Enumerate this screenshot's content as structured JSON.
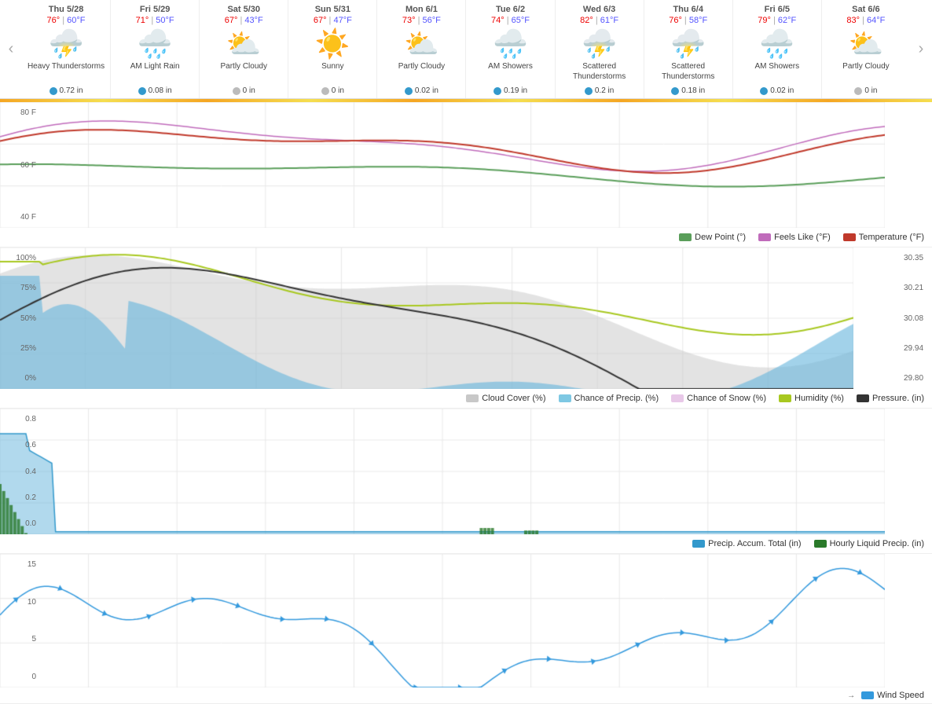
{
  "nav": {
    "prev_label": "‹",
    "next_label": "›"
  },
  "days": [
    {
      "id": "thu-528",
      "name": "Thu 5/28",
      "high": "76°",
      "low": "60°F",
      "icon": "⛈️",
      "icon_type": "storm",
      "desc": "Heavy Thunderstorms",
      "precip": "0.72 in",
      "precip_type": "blue"
    },
    {
      "id": "fri-529",
      "name": "Fri 5/29",
      "high": "71°",
      "low": "50°F",
      "icon": "🌧️",
      "icon_type": "rain",
      "desc": "AM Light Rain",
      "precip": "0.08 in",
      "precip_type": "blue"
    },
    {
      "id": "sat-530",
      "name": "Sat 5/30",
      "high": "67°",
      "low": "43°F",
      "icon": "⛅",
      "icon_type": "partly",
      "desc": "Partly Cloudy",
      "precip": "0 in",
      "precip_type": "gray"
    },
    {
      "id": "sun-531",
      "name": "Sun 5/31",
      "high": "67°",
      "low": "47°F",
      "icon": "☀️",
      "icon_type": "sunny",
      "desc": "Sunny",
      "precip": "0 in",
      "precip_type": "gray"
    },
    {
      "id": "mon-61",
      "name": "Mon 6/1",
      "high": "73°",
      "low": "56°F",
      "icon": "⛅",
      "icon_type": "partly",
      "desc": "Partly Cloudy",
      "precip": "0.02 in",
      "precip_type": "blue"
    },
    {
      "id": "tue-62",
      "name": "Tue 6/2",
      "high": "74°",
      "low": "65°F",
      "icon": "🌧️",
      "icon_type": "showers",
      "desc": "AM Showers",
      "precip": "0.19 in",
      "precip_type": "blue"
    },
    {
      "id": "wed-63",
      "name": "Wed 6/3",
      "high": "82°",
      "low": "61°F",
      "icon": "⛈️",
      "icon_type": "storm",
      "desc": "Scattered Thunderstorms",
      "precip": "0.2 in",
      "precip_type": "blue"
    },
    {
      "id": "thu-64",
      "name": "Thu 6/4",
      "high": "76°",
      "low": "58°F",
      "icon": "⛈️",
      "icon_type": "storm",
      "desc": "Scattered Thunderstorms",
      "precip": "0.18 in",
      "precip_type": "blue"
    },
    {
      "id": "fri-65",
      "name": "Fri 6/5",
      "high": "79°",
      "low": "62°F",
      "icon": "🌧️",
      "icon_type": "showers",
      "desc": "AM Showers",
      "precip": "0.02 in",
      "precip_type": "blue"
    },
    {
      "id": "sat-66",
      "name": "Sat 6/6",
      "high": "83°",
      "low": "64°F",
      "icon": "⛅",
      "icon_type": "partly-sunny",
      "desc": "Partly Cloudy",
      "precip": "0 in",
      "precip_type": "gray"
    }
  ],
  "temp_chart": {
    "y_labels": [
      "80 F",
      "60 F",
      "40 F"
    ],
    "legend": [
      {
        "label": "Dew Point (°)",
        "color": "#5a9e5a"
      },
      {
        "label": "Feels Like (°F)",
        "color": "#c06bbb"
      },
      {
        "label": "Temperature (°F)",
        "color": "#c0392b"
      }
    ]
  },
  "precip_chart": {
    "y_labels": [
      "100%",
      "75%",
      "50%",
      "25%",
      "0%"
    ],
    "y_labels_right": [
      "30.35",
      "30.21",
      "30.08",
      "29.94",
      "29.80"
    ],
    "legend": [
      {
        "label": "Cloud Cover (%)",
        "color": "#c8c8c8"
      },
      {
        "label": "Chance of Precip. (%)",
        "color": "#7ec8e3"
      },
      {
        "label": "Chance of Snow (%)",
        "color": "#e8c8e8"
      },
      {
        "label": "Humidity (%)",
        "color": "#a8c820"
      },
      {
        "label": "Pressure. (in)",
        "color": "#333"
      }
    ]
  },
  "accum_chart": {
    "y_labels": [
      "0.8",
      "0.6",
      "0.4",
      "0.2",
      "0.0"
    ],
    "legend": [
      {
        "label": "Precip. Accum. Total (in)",
        "color": "#3399cc"
      },
      {
        "label": "Hourly Liquid Precip. (in)",
        "color": "#2a7a2a"
      }
    ]
  },
  "wind_chart": {
    "y_labels": [
      "15",
      "10",
      "5",
      "0"
    ],
    "legend": [
      {
        "label": "Wind Speed",
        "color": "#3399dd"
      }
    ]
  }
}
